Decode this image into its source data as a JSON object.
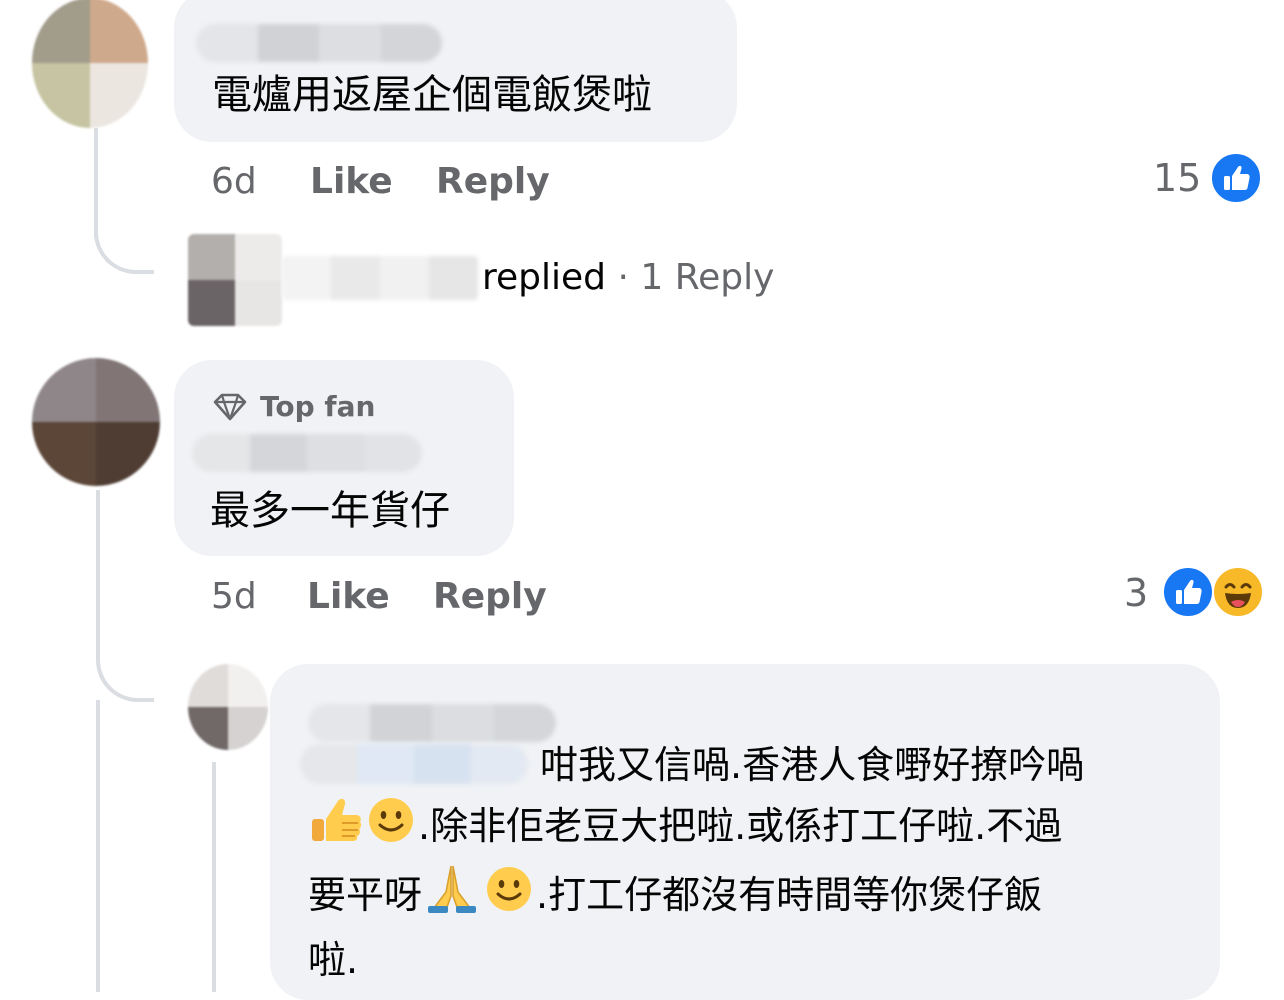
{
  "comments": [
    {
      "text": "電爐用返屋企個電飯煲啦",
      "time": "6d",
      "like_label": "Like",
      "reply_label": "Reply",
      "reaction_count": "15",
      "reactions": [
        "like-icon"
      ],
      "replies_summary": {
        "replied_label": "replied",
        "separator": "·",
        "count_label": "1 Reply"
      }
    },
    {
      "badge": "Top fan",
      "badge_icon": "diamond-icon",
      "text": "最多一年貨仔",
      "time": "5d",
      "like_label": "Like",
      "reply_label": "Reply",
      "reaction_count": "3",
      "reactions": [
        "like-icon",
        "haha-icon"
      ]
    }
  ],
  "reply": {
    "segments": {
      "l1": "咁我又信喎.香港人食嘢好撩吟喎",
      "l2": ".除非佢老豆大把啦.或係打工仔啦.不過",
      "l3a": "要平呀",
      "l3b": ".打工仔都沒有時間等你煲仔飯",
      "l4": "啦."
    },
    "emojis": [
      "thumbs-up-emoji",
      "slightly-smiling-emoji",
      "folded-hands-emoji",
      "slightly-smiling-emoji"
    ]
  },
  "colors": {
    "bubble": "#f0f2f5",
    "meta_text": "#65676b",
    "like_blue": "#1877f2",
    "haha_yellow": "#f7b928",
    "thread_line": "#dadde1"
  }
}
